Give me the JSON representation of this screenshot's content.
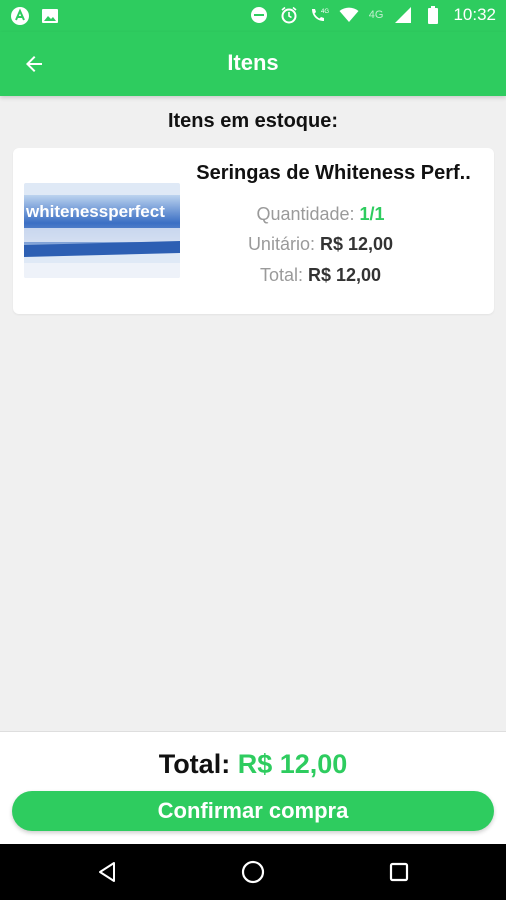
{
  "status_bar": {
    "time": "10:32",
    "network_label": "4G",
    "icons": [
      "app-icon",
      "image-icon",
      "do-not-disturb-icon",
      "alarm-icon",
      "call-4g-icon",
      "wifi-icon",
      "signal-icon",
      "battery-icon"
    ]
  },
  "app_bar": {
    "title": "Itens",
    "back_icon": "arrow-back-icon"
  },
  "section": {
    "title": "Itens em estoque:"
  },
  "item": {
    "name": "Seringas de Whiteness Perf..",
    "image_text": "whitenessperfect",
    "quantity_label": "Quantidade:",
    "quantity_value": "1/1",
    "unit_label": "Unitário:",
    "unit_value": "R$ 12,00",
    "total_label": "Total:",
    "total_value": "R$ 12,00"
  },
  "footer": {
    "total_label": "Total:",
    "total_value": "R$ 12,00",
    "confirm_label": "Confirmar compra"
  },
  "colors": {
    "primary": "#2ecc5f",
    "background": "#f0f0f0"
  }
}
